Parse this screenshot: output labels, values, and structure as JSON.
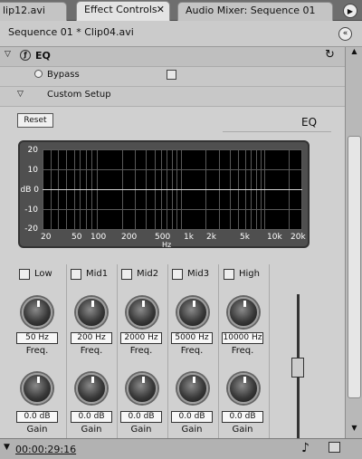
{
  "tabs": [
    {
      "label": "lip12.avi"
    },
    {
      "label": "Effect Controls"
    },
    {
      "label": "Audio Mixer: Sequence 01"
    }
  ],
  "sequence": {
    "title": "Sequence 01 * Clip04.avi"
  },
  "effect": {
    "name": "EQ",
    "bypass_label": "Bypass",
    "custom_setup_label": "Custom Setup"
  },
  "custom": {
    "reset_label": "Reset",
    "eq_label": "EQ"
  },
  "graph": {
    "y_ticks": [
      "20",
      "10",
      "dB 0",
      "-10",
      "-20"
    ],
    "x_ticks": [
      "20",
      "50",
      "100",
      "200",
      "500",
      "1k",
      "2k",
      "5k",
      "10k",
      "20k"
    ],
    "x_unit": "Hz"
  },
  "bands": [
    {
      "name": "Low",
      "freq": "50 Hz",
      "freq_label": "Freq.",
      "gain": "0.0 dB",
      "gain_label": "Gain"
    },
    {
      "name": "Mid1",
      "freq": "200 Hz",
      "freq_label": "Freq.",
      "gain": "0.0 dB",
      "gain_label": "Gain"
    },
    {
      "name": "Mid2",
      "freq": "2000 Hz",
      "freq_label": "Freq.",
      "gain": "0.0 dB",
      "gain_label": "Gain"
    },
    {
      "name": "Mid3",
      "freq": "5000 Hz",
      "freq_label": "Freq.",
      "gain": "0.0 dB",
      "gain_label": "Gain"
    },
    {
      "name": "High",
      "freq": "10000 Hz",
      "freq_label": "Freq.",
      "gain": "0.0 dB",
      "gain_label": "Gain"
    }
  ],
  "status": {
    "timecode": "00:00:29:16"
  }
}
